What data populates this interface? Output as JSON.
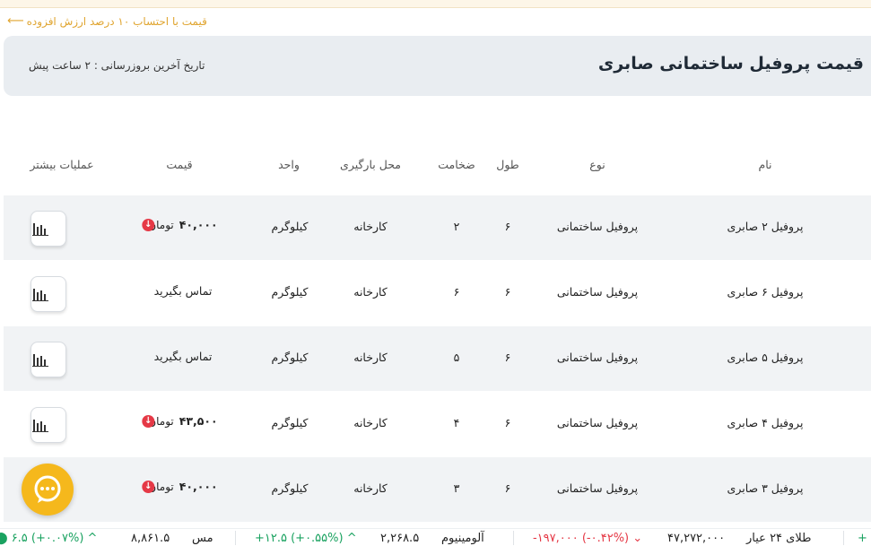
{
  "vat_note": "قیمت با احتساب ۱۰ درصد ارزش افزوده",
  "page_title": "قیمت پروفیل ساختمانی صابری",
  "last_update": "تاریخ آخرین بروزرسانی : ۲ ساعت پیش",
  "table": {
    "headers": {
      "name": "نام",
      "type": "نوع",
      "length": "طول",
      "thickness": "ضخامت",
      "loading_place": "محل بارگیری",
      "unit": "واحد",
      "price": "قیمت",
      "more_ops": "عملیات بیشتر"
    },
    "rows": [
      {
        "name": "پروفیل ۲ صابری",
        "type": "پروفیل ساختمانی",
        "length": "۶",
        "thickness": "۲",
        "place": "کارخانه",
        "unit": "کیلوگرم",
        "price": "۴۰,۰۰۰",
        "currency": "تومان",
        "contact": ""
      },
      {
        "name": "پروفیل ۶ صابری",
        "type": "پروفیل ساختمانی",
        "length": "۶",
        "thickness": "۶",
        "place": "کارخانه",
        "unit": "کیلوگرم",
        "price": "",
        "currency": "",
        "contact": "تماس بگیرید"
      },
      {
        "name": "پروفیل ۵ صابری",
        "type": "پروفیل ساختمانی",
        "length": "۶",
        "thickness": "۵",
        "place": "کارخانه",
        "unit": "کیلوگرم",
        "price": "",
        "currency": "",
        "contact": "تماس بگیرید"
      },
      {
        "name": "پروفیل ۴ صابری",
        "type": "پروفیل ساختمانی",
        "length": "۶",
        "thickness": "۴",
        "place": "کارخانه",
        "unit": "کیلوگرم",
        "price": "۴۳,۵۰۰",
        "currency": "تومان",
        "contact": ""
      },
      {
        "name": "پروفیل ۳ صابری",
        "type": "پروفیل ساختمانی",
        "length": "۶",
        "thickness": "۳",
        "place": "کارخانه",
        "unit": "کیلوگرم",
        "price": "۴۰,۰۰۰",
        "currency": "تومان",
        "contact": ""
      }
    ]
  },
  "ticker": {
    "gold_name": "طلای ۲۴ عیار",
    "gold_price": "۴۷,۲۷۲,۰۰۰",
    "gold_change": "-۱۹۷,۰۰۰ (-۰.۴۲%)",
    "alu_name": "آلومینیوم",
    "alu_price": "۲,۲۶۸.۵",
    "alu_change": "+۱۲.۵ (+۰.۵۵%)",
    "copper_name": "مس",
    "copper_price": "۸,۸۶۱.۵",
    "copper_change": "۶.۵ (+۰.۰۷%)"
  },
  "colors": {
    "accent": "#f5b81c",
    "up": "#1aa260",
    "down": "#e53946"
  }
}
